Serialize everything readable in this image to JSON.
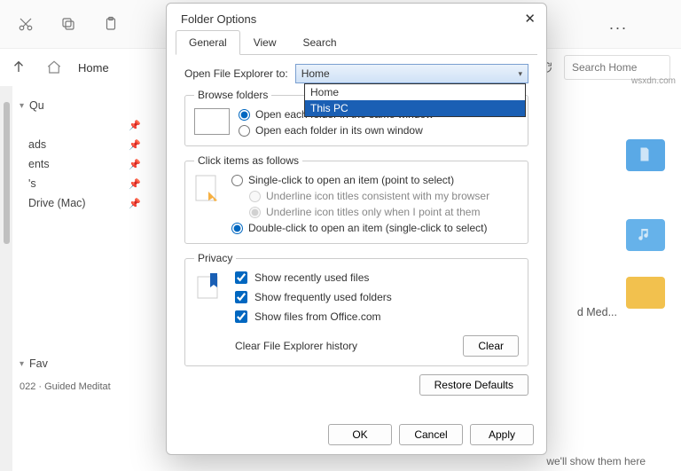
{
  "toolbar": {
    "more": "..."
  },
  "breadcrumb": {
    "home": "Home"
  },
  "search": {
    "placeholder": "Search Home"
  },
  "sidebar": {
    "qu": "Qu",
    "items": [
      "",
      "ads",
      "ents",
      "'s",
      "Drive (Mac)"
    ],
    "fav": "Fav",
    "footer": "022 · Guided Meditat"
  },
  "content": {
    "dmed": "d Med...",
    "foot": "we'll show them here"
  },
  "dialog": {
    "title": "Folder Options",
    "tabs": [
      "General",
      "View",
      "Search"
    ],
    "open_label": "Open File Explorer to:",
    "combo_value": "Home",
    "dropdown": [
      "Home",
      "This PC"
    ],
    "browse": {
      "legend": "Browse folders",
      "same": "Open each folder in the same window",
      "own": "Open each folder in its own window"
    },
    "click": {
      "legend": "Click items as follows",
      "single": "Single-click to open an item (point to select)",
      "ul_browser": "Underline icon titles consistent with my browser",
      "ul_point": "Underline icon titles only when I point at them",
      "double": "Double-click to open an item (single-click to select)"
    },
    "privacy": {
      "legend": "Privacy",
      "recent": "Show recently used files",
      "freq": "Show frequently used folders",
      "office": "Show files from Office.com",
      "clear_label": "Clear File Explorer history",
      "clear_btn": "Clear"
    },
    "restore": "Restore Defaults",
    "ok": "OK",
    "cancel": "Cancel",
    "apply": "Apply"
  },
  "watermark": "wsxdn.com"
}
